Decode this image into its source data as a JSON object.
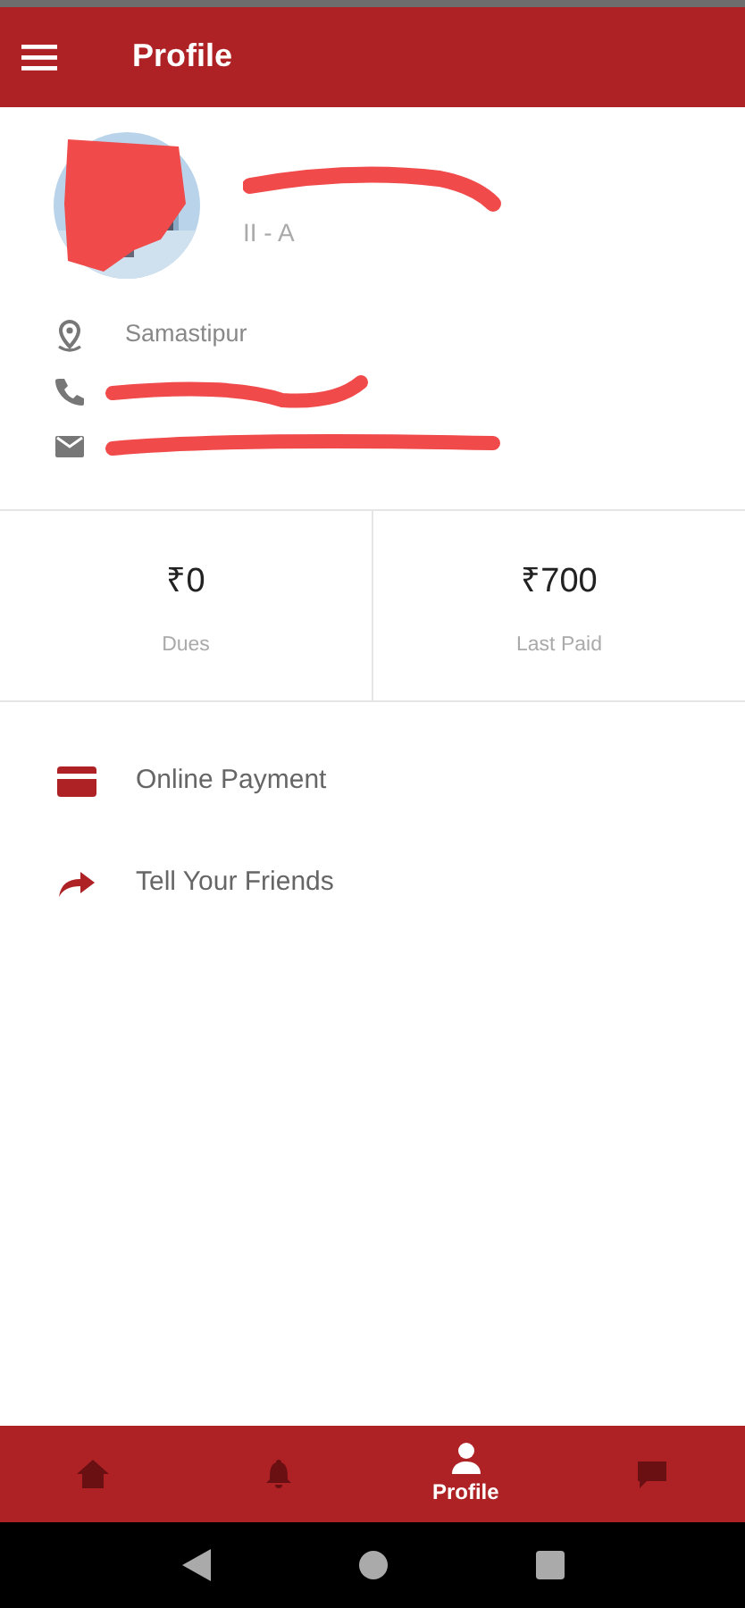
{
  "app_bar": {
    "title": "Profile"
  },
  "profile": {
    "class": "II - A",
    "details": [
      {
        "kind": "location",
        "text": "Samastipur",
        "redacted": false
      },
      {
        "kind": "phone",
        "redacted": true
      },
      {
        "kind": "email",
        "redacted": true
      }
    ]
  },
  "stats": [
    {
      "value": "₹0",
      "label": "Dues"
    },
    {
      "value": "₹700",
      "label": "Last Paid"
    }
  ],
  "menu": [
    {
      "kind": "card",
      "label": "Online Payment"
    },
    {
      "kind": "share",
      "label": "Tell Your Friends"
    }
  ],
  "bottom_nav": [
    {
      "kind": "home",
      "selected": false
    },
    {
      "kind": "bell",
      "selected": false
    },
    {
      "kind": "person",
      "selected": true,
      "label": "Profile"
    },
    {
      "kind": "chat",
      "selected": false
    }
  ]
}
